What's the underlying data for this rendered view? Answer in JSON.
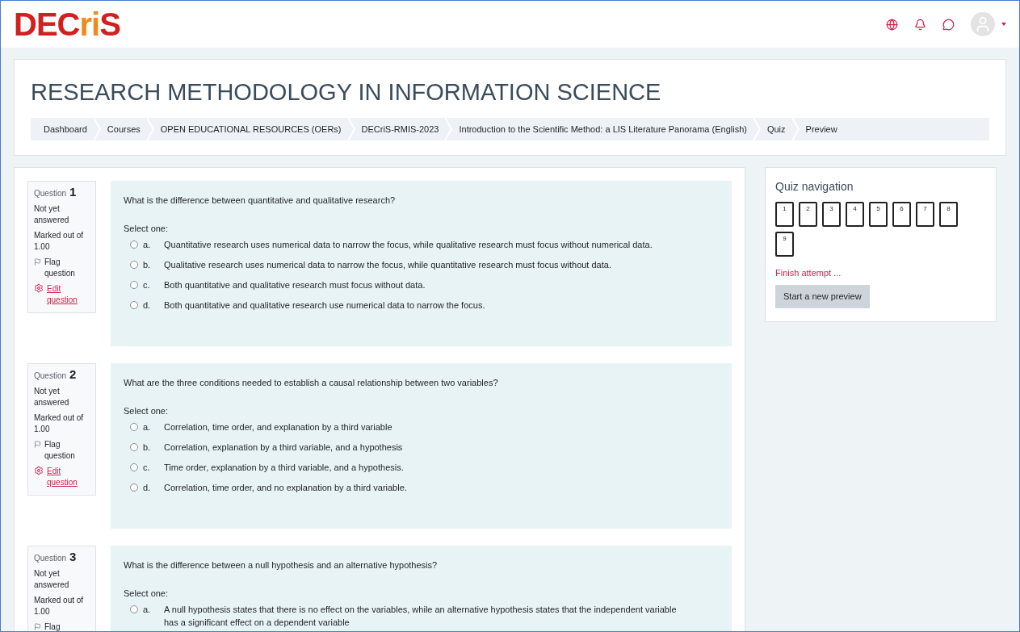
{
  "logo": [
    {
      "text": "DEC",
      "color": "#d21f1f"
    },
    {
      "text": "ri",
      "color": "#f08a1c"
    },
    {
      "text": "S",
      "color": "#d21f1f"
    }
  ],
  "course": {
    "title": "RESEARCH METHODOLOGY IN INFORMATION SCIENCE",
    "breadcrumb": [
      "Dashboard",
      "Courses",
      "OPEN EDUCATIONAL RESOURCES (OERs)",
      "DECriS-RMIS-2023",
      "Introduction to the Scientific Method: a LIS Literature Panorama (English)",
      "Quiz",
      "Preview"
    ]
  },
  "questions": [
    {
      "label": "Question",
      "number": "1",
      "status": "Not yet answered",
      "marked": "Marked out of 1.00",
      "flag": "Flag question",
      "edit": "Edit question",
      "text": "What is the difference between quantitative and qualitative research?",
      "prompt": "Select one:",
      "options": [
        {
          "letter": "a.",
          "text": "Quantitative research uses numerical data to narrow the focus, while qualitative research must focus without numerical data.",
          "selected": false
        },
        {
          "letter": "b.",
          "text": "Qualitative research uses numerical data to narrow the focus, while quantitative research must focus without data.",
          "selected": false
        },
        {
          "letter": "c.",
          "text": "Both quantitative and qualitative research must focus without data.",
          "selected": false
        },
        {
          "letter": "d.",
          "text": "Both quantitative and qualitative research use numerical data to narrow the focus.",
          "selected": false
        }
      ]
    },
    {
      "label": "Question",
      "number": "2",
      "status": "Not yet answered",
      "marked": "Marked out of 1.00",
      "flag": "Flag question",
      "edit": "Edit question",
      "text": "What are the three conditions needed to establish a causal relationship between two variables?",
      "prompt": "Select one:",
      "options": [
        {
          "letter": "a.",
          "text": "Correlation, time order, and explanation by a third variable",
          "selected": false
        },
        {
          "letter": "b.",
          "text": "Correlation, explanation by a third variable, and a hypothesis",
          "selected": false
        },
        {
          "letter": "c.",
          "text": "Time order, explanation by a third variable, and a hypothesis.",
          "selected": false
        },
        {
          "letter": "d.",
          "text": "Correlation, time order, and no explanation by a third variable.",
          "selected": false
        }
      ]
    },
    {
      "label": "Question",
      "number": "3",
      "status": "Not yet answered",
      "marked": "Marked out of 1.00",
      "flag": "Flag",
      "text": "What is the difference between a null hypothesis and an alternative hypothesis?",
      "prompt": "Select one:",
      "options": [
        {
          "letter": "a.",
          "text": "A null hypothesis states that there is no effect on the variables, while an alternative hypothesis states that the independent variable has a significant effect on a dependent variable",
          "selected": false
        }
      ]
    }
  ],
  "quiz_navigation": {
    "title": "Quiz navigation",
    "buttons": [
      "1",
      "2",
      "3",
      "4",
      "5",
      "6",
      "7",
      "8",
      "9"
    ],
    "finish": "Finish attempt ...",
    "new_preview": "Start a new preview"
  }
}
